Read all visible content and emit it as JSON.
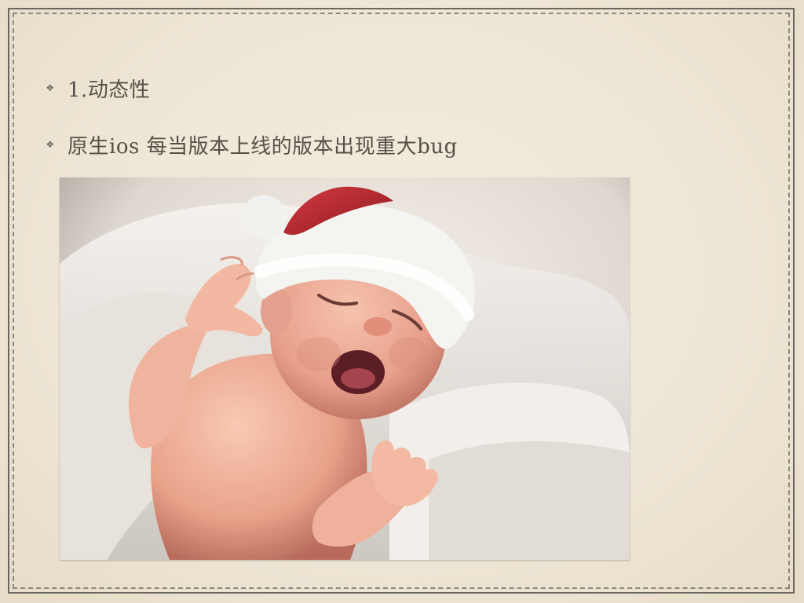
{
  "slide": {
    "bullets": [
      {
        "text": "1.动态性",
        "marker_icon": "diamond-flower-bullet-icon"
      },
      {
        "text": "原生ios  每当版本上线的版本出现重大bug",
        "marker_icon": "diamond-flower-bullet-icon"
      }
    ],
    "image": {
      "subject": "crying-newborn-in-santa-hat",
      "colors": {
        "background": "#e9e1d8",
        "blanket": "#d9d4ce",
        "skin": "#f0b29d",
        "hat_red": "#b9252d",
        "hat_white": "#f3f3f0"
      }
    }
  }
}
